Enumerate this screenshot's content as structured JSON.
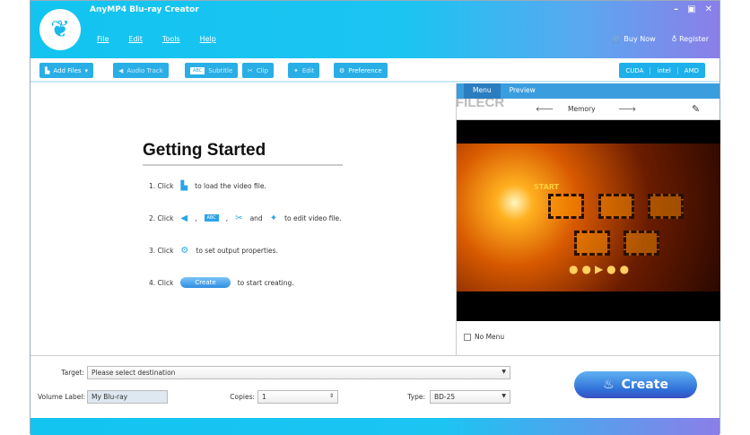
{
  "app": {
    "title": "AnyMP4 Blu-ray Creator"
  },
  "menu": [
    "File",
    "Edit",
    "Tools",
    "Help"
  ],
  "header_links": {
    "buy": "Buy Now",
    "register": "Register"
  },
  "toolbar": {
    "add_files": "Add Files",
    "audio_track": "Audio Track",
    "subtitle": "Subtitle",
    "clip": "Clip",
    "edit": "Edit",
    "preference": "Preference",
    "abc": "ABC"
  },
  "gpu": {
    "cuda": "CUDA",
    "intel": "intel",
    "amd": "AMD"
  },
  "getting_started": {
    "title": "Getting Started",
    "s1a": "1. Click",
    "s1b": "to load the video file.",
    "s2a": "2. Click",
    "s2b": ",",
    "s2c": ",",
    "s2d": "and",
    "s2e": "to edit video file.",
    "s3a": "3. Click",
    "s3b": "to set output properties.",
    "s4a": "4. Click",
    "s4btn": "Create",
    "s4b": "to start creating."
  },
  "preview": {
    "tabs": [
      "Menu",
      "Preview"
    ],
    "template": "Memory",
    "no_menu": "No Menu",
    "start": "START"
  },
  "watermark": "FILECR",
  "bottom": {
    "target_label": "Target:",
    "target_value": "Please select destination",
    "volume_label": "Volume Label:",
    "volume_value": "My Blu-ray",
    "copies_label": "Copies:",
    "copies_value": "1",
    "type_label": "Type:",
    "type_value": "BD-25",
    "create": "Create"
  }
}
